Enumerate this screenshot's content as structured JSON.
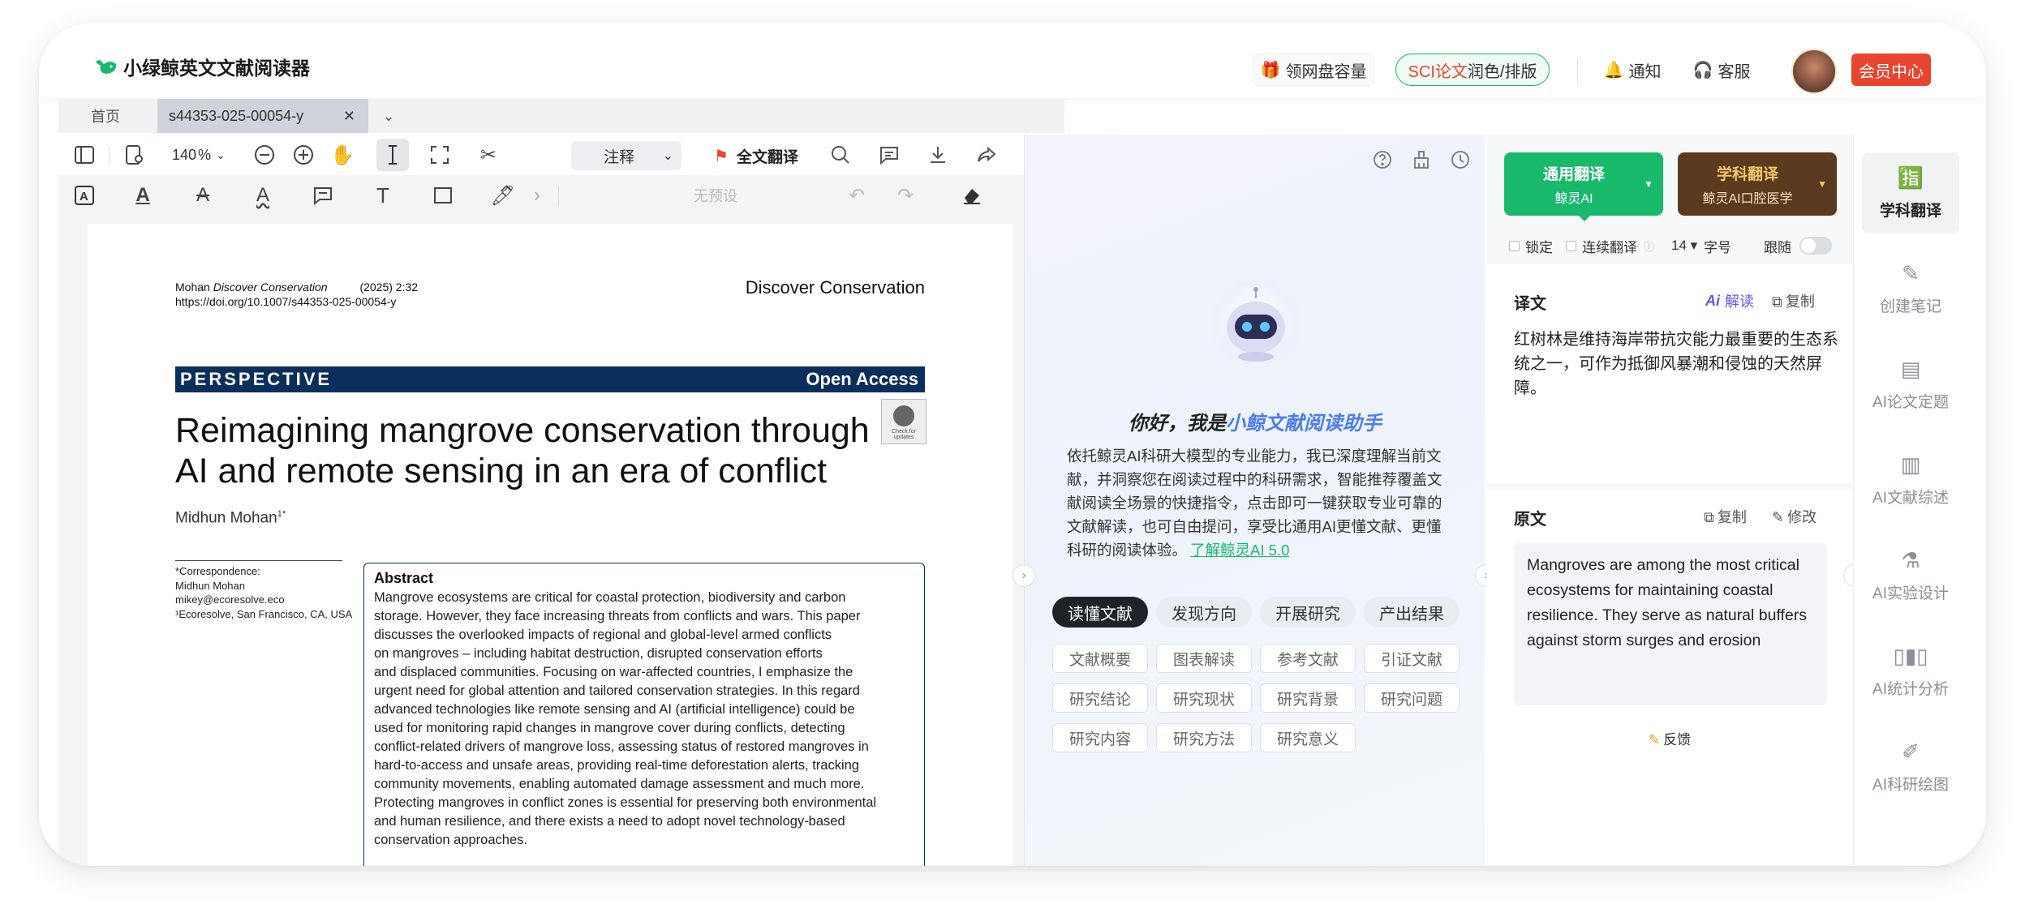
{
  "app": {
    "name": "小绿鲸英文文献阅读器"
  },
  "header": {
    "cloud": "领网盘容量",
    "sci_a": "SCI论文",
    "sci_b": "润色/排版",
    "notify": "通知",
    "service": "客服",
    "vip": "会员中心"
  },
  "tabs": {
    "home": "首页",
    "doc": "s44353-025-00054-y"
  },
  "toolbar": {
    "zoom": "140",
    "zoom_unit": "%",
    "annotate": "注释",
    "translate_all": "全文翻译",
    "preset": "无预设"
  },
  "paper": {
    "journal_author": "Mohan",
    "journal_name": "Discover Conservation",
    "year_vol": "(2025) 2:32",
    "doi": "https://doi.org/10.1007/s44353-025-00054-y",
    "header_right": "Discover Conservation",
    "type": "PERSPECTIVE",
    "access": "Open Access",
    "title_l1": "Reimagining mangrove conservation through",
    "title_l2": "AI and remote sensing in an era of conflict",
    "author": "Midhun Mohan",
    "author_sup": "1*",
    "check_l1": "Check for",
    "check_l2": "updates",
    "corr": [
      "*Correspondence:",
      "Midhun Mohan",
      "mikey@ecoresolve.eco",
      "¹Ecoresolve, San Francisco, CA, USA"
    ],
    "abstract_h": "Abstract",
    "abstract": [
      "Mangrove ecosystems are critical for coastal protection, biodiversity and carbon",
      "storage. However, they face increasing threats from conflicts and wars. This paper",
      "discusses the overlooked impacts of regional and global-level armed conflicts",
      "on mangroves – including habitat destruction, disrupted conservation efforts",
      "and displaced communities. Focusing on war-affected countries, I emphasize the",
      "urgent need for global attention and tailored conservation strategies. In this regard",
      "advanced technologies like remote sensing and AI (artificial intelligence) could be",
      "used for monitoring rapid changes in mangrove cover during conflicts, detecting",
      "conflict-related drivers of mangrove loss, assessing status of restored mangroves in",
      "hard-to-access and unsafe areas, providing real-time deforestation alerts, tracking",
      "community movements, enabling automated damage assessment and much more.",
      "Protecting mangroves in conflict zones is essential for preserving both environmental",
      "and human resilience, and there exists a need to adopt novel technology-based",
      "conservation approaches."
    ]
  },
  "assistant": {
    "greet_a": "你好，我是",
    "greet_b": "小鲸文献阅读助手",
    "desc": [
      "依托鲸灵AI科研大模型的专业能力，我已深度理解当前文",
      "献，并洞察您在阅读过程中的科研需求，智能推荐覆盖文",
      "献阅读全场景的快捷指令，点击即可一键获取专业可靠的",
      "文献解读，也可自由提问，享受比通用AI更懂文献、更懂",
      "科研的阅读体验。"
    ],
    "link": "了解鲸灵AI 5.0",
    "pills": [
      "读懂文献",
      "发现方向",
      "开展研究",
      "产出结果"
    ],
    "chips": [
      "文献概要",
      "图表解读",
      "参考文献",
      "引证文献",
      "研究结论",
      "研究现状",
      "研究背景",
      "研究问题",
      "研究内容",
      "研究方法",
      "研究意义"
    ]
  },
  "translate": {
    "btn1_a": "通用翻译",
    "btn1_b": "鲸灵AI",
    "btn2_a": "学科翻译",
    "btn2_b": "鲸灵AI口腔医学",
    "lock": "锁定",
    "continuous": "连续翻译",
    "font_size": "14",
    "font_label": "字号",
    "follow": "跟随",
    "trans_label": "译文",
    "interpret": "解读",
    "copy": "复制",
    "trans_lines": [
      "红树林是维持海岸带抗灾能力最重要的生态系",
      "统之一，可作为抵御风暴潮和侵蚀的天然屏",
      "障。"
    ],
    "orig_label": "原文",
    "edit": "修改",
    "orig_lines": [
      "Mangroves are among the most critical",
      "ecosystems for maintaining coastal",
      "resilience. They serve as natural buffers",
      "against storm surges and erosion"
    ],
    "feedback": "反馈"
  },
  "sidebar": {
    "items": [
      "学科翻译",
      "创建笔记",
      "AI论文定题",
      "AI文献综述",
      "AI实验设计",
      "AI统计分析",
      "AI科研绘图"
    ]
  },
  "colors": {
    "green": "#19b96c",
    "brand_red": "#e8452f",
    "navy": "#0b2f5c"
  }
}
